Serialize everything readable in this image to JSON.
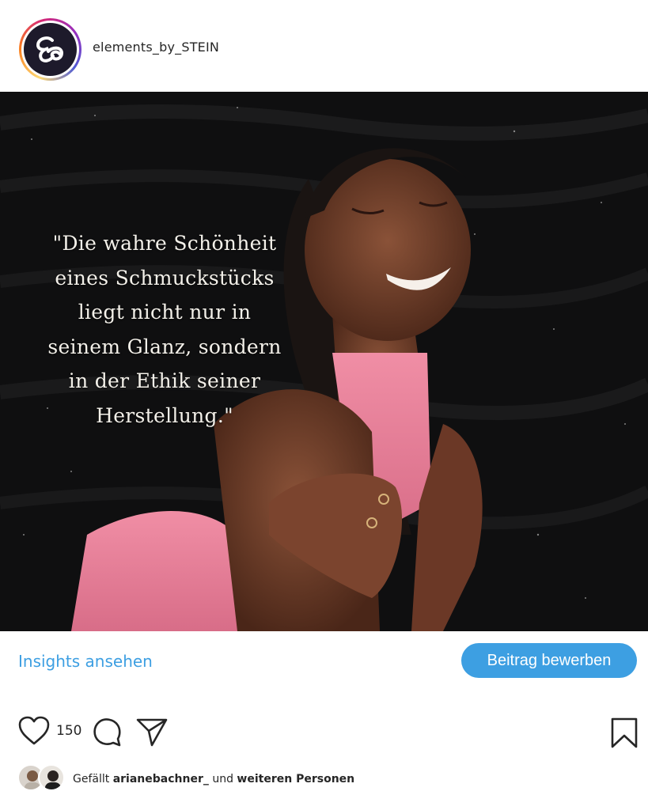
{
  "header": {
    "username": "elements_by_STEIN",
    "avatar_icon": "brand-logo-icon"
  },
  "post": {
    "quote": "\"Die wahre Schönheit\neines Schmuckstücks\nliegt nicht nur in\nseinem Glanz, sondern\nin der Ethik seiner\nHerstellung.\"",
    "image_description_colors": {
      "background": "#0d0d0d",
      "top_color": "#e8849a"
    }
  },
  "actions": {
    "insights_label": "Insights ansehen",
    "promote_label": "Beitrag bewerben",
    "likes_count": "150",
    "icons": [
      "heart-icon",
      "comment-icon",
      "share-icon",
      "bookmark-icon"
    ]
  },
  "liked_by": {
    "prefix": "Gefällt",
    "user": "arianebachner_",
    "middle": "und",
    "suffix": "weiteren Personen"
  },
  "colors": {
    "accent": "#3d9fe2",
    "text": "#262626"
  }
}
